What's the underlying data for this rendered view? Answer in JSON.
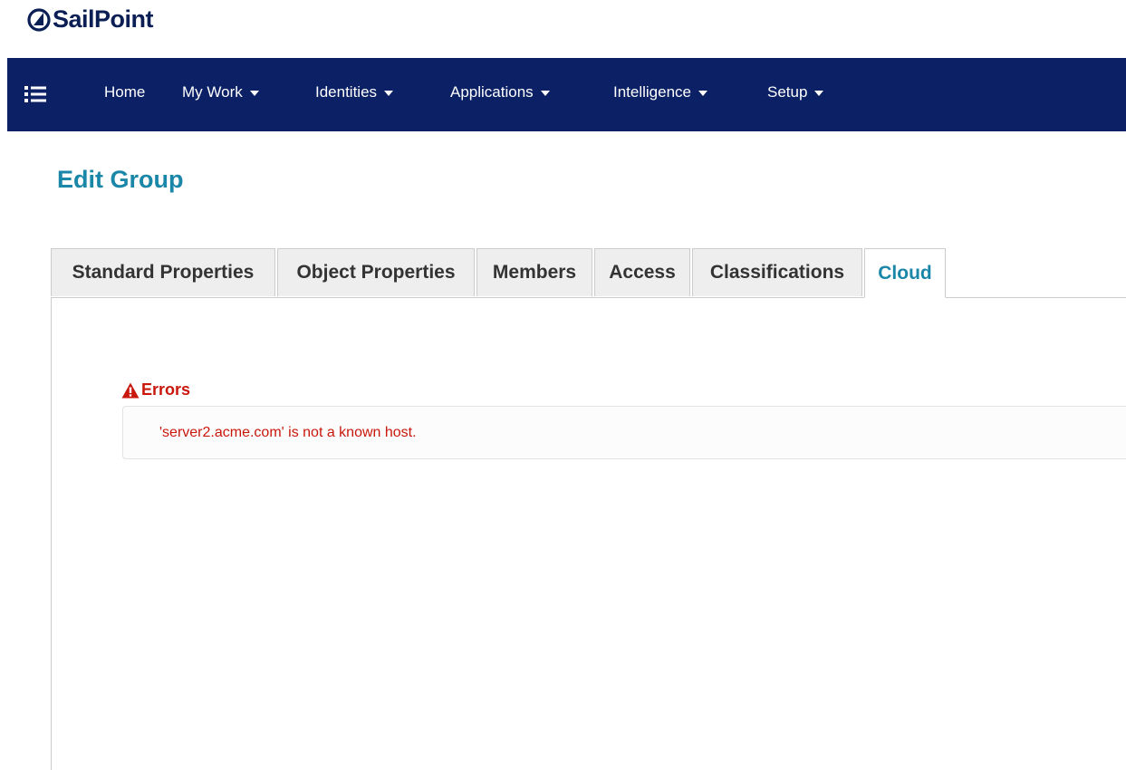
{
  "brand": {
    "name": "SailPoint",
    "logo_icon": "sailpoint-logo-icon",
    "color": "#0b1f55"
  },
  "nav": {
    "background": "#0b2065",
    "menu_icon": "list-menu-icon",
    "items": [
      {
        "label": "Home",
        "has_dropdown": false
      },
      {
        "label": "My Work",
        "has_dropdown": true
      },
      {
        "label": "Identities",
        "has_dropdown": true
      },
      {
        "label": "Applications",
        "has_dropdown": true
      },
      {
        "label": "Intelligence",
        "has_dropdown": true
      },
      {
        "label": "Setup",
        "has_dropdown": true
      }
    ]
  },
  "page": {
    "title": "Edit Group",
    "title_color": "#1a86a8"
  },
  "tabs": [
    {
      "label": "Standard Properties",
      "active": false
    },
    {
      "label": "Object Properties",
      "active": false
    },
    {
      "label": "Members",
      "active": false
    },
    {
      "label": "Access",
      "active": false
    },
    {
      "label": "Classifications",
      "active": false
    },
    {
      "label": "Cloud",
      "active": true
    }
  ],
  "errors": {
    "heading": "Errors",
    "icon": "warning-triangle-icon",
    "color": "#c9170c",
    "messages": [
      "'server2.acme.com' is not a known host."
    ]
  }
}
